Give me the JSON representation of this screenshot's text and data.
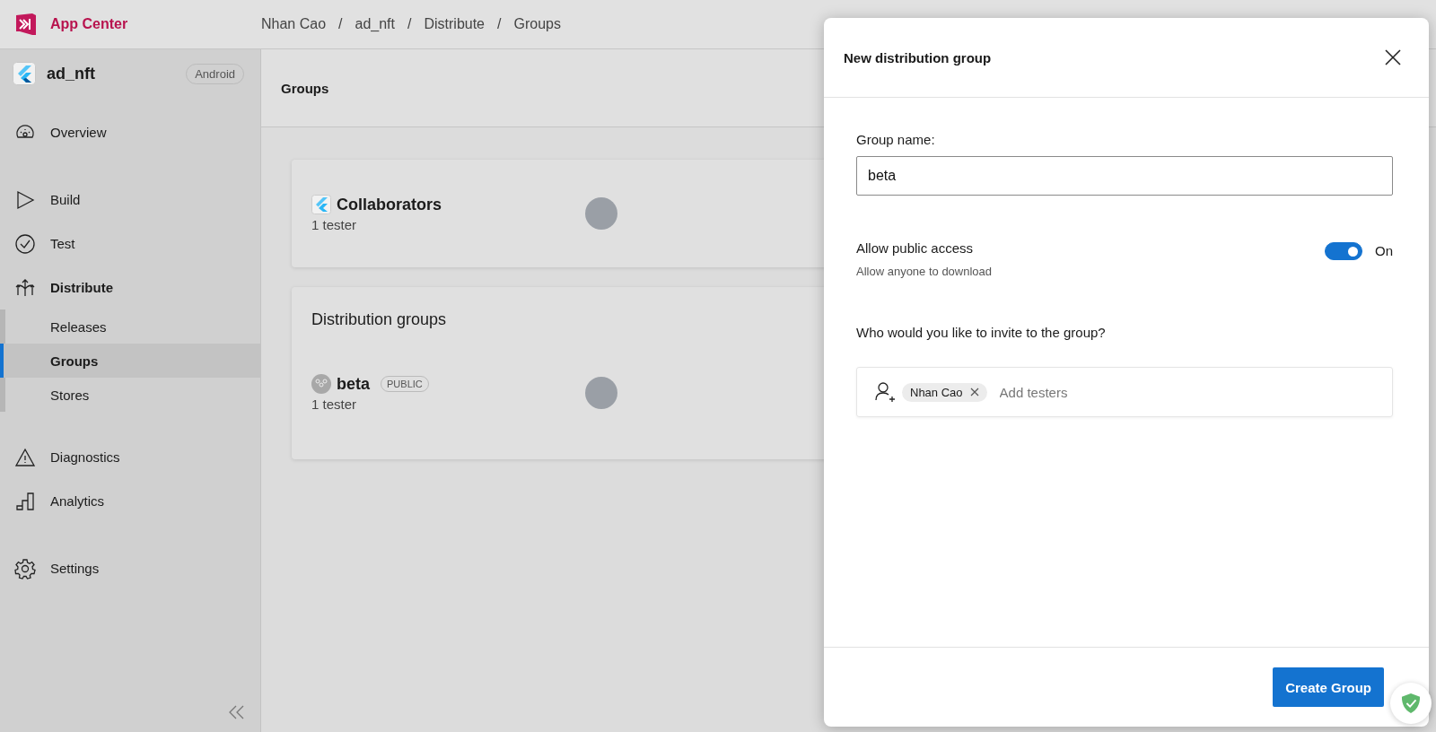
{
  "app": {
    "name": "App Center"
  },
  "breadcrumbs": {
    "separator": "/",
    "items": [
      "Nhan Cao",
      "ad_nft",
      "Distribute",
      "Groups"
    ]
  },
  "sidebar": {
    "app_name": "ad_nft",
    "platform": "Android",
    "sections": [
      {
        "items": [
          {
            "label": "Overview",
            "selected": false
          }
        ]
      },
      {
        "items": [
          {
            "label": "Build",
            "selected": false
          },
          {
            "label": "Test",
            "selected": false
          },
          {
            "label": "Distribute",
            "selected": false,
            "expanded": true,
            "children": [
              {
                "label": "Releases",
                "selected": false
              },
              {
                "label": "Groups",
                "selected": true
              },
              {
                "label": "Stores",
                "selected": false
              }
            ]
          }
        ]
      },
      {
        "items": [
          {
            "label": "Diagnostics",
            "selected": false
          },
          {
            "label": "Analytics",
            "selected": false
          }
        ]
      },
      {
        "items": [
          {
            "label": "Settings",
            "selected": false
          }
        ]
      }
    ]
  },
  "main": {
    "page_title": "Groups",
    "collaborators": {
      "name": "Collaborators",
      "count": "1 tester"
    },
    "distribution_groups": {
      "title": "Distribution groups",
      "groups": [
        {
          "name": "beta",
          "badge": "PUBLIC",
          "count": "1 tester"
        }
      ]
    }
  },
  "panel": {
    "title": "New distribution group",
    "group_name_label": "Group name:",
    "group_name_value": "beta",
    "public_access": {
      "label": "Allow public access",
      "description": "Allow anyone to download",
      "on": true,
      "state_label": "On"
    },
    "invite_label": "Who would you like to invite to the group?",
    "testers": [
      {
        "name": "Nhan Cao"
      }
    ],
    "testers_placeholder": "Add testers",
    "submit": "Create Group"
  }
}
